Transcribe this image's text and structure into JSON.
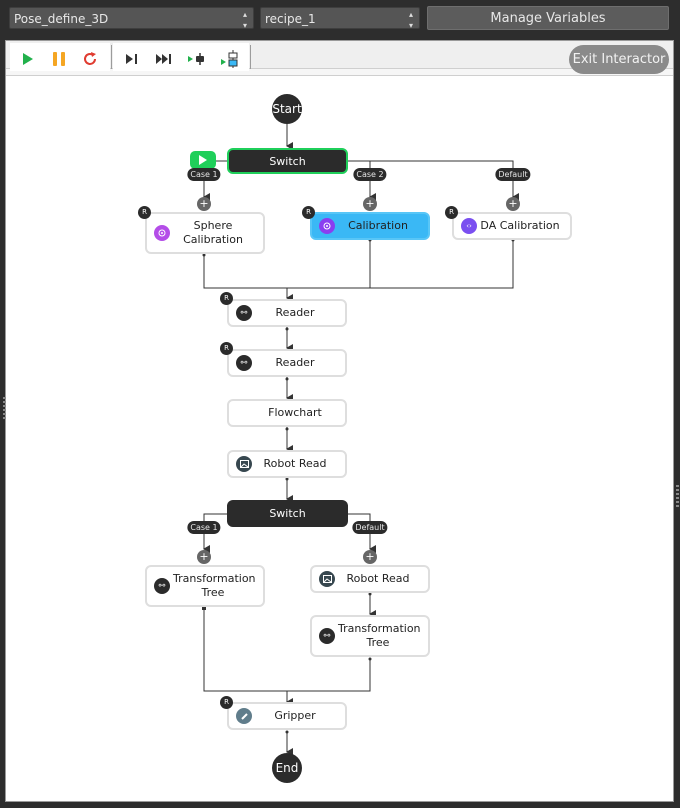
{
  "topbar": {
    "flow_select": "Pose_define_3D",
    "recipe_select": "recipe_1",
    "manage_variables_label": "Manage Variables"
  },
  "toolbar": {
    "run_icon": "play-icon",
    "pause_icon": "pause-icon",
    "reset_icon": "restart-icon",
    "step_icon": "step-icon",
    "step_all_icon": "fast-forward-icon",
    "breakpoint_icon": "breakpoint-icon",
    "run_to_node_icon": "run-to-node-icon",
    "exit_label": "Exit Interactor",
    "colors": {
      "play": "#22b14c",
      "pause": "#f5a623",
      "reset": "#e03c31"
    }
  },
  "flow": {
    "start_label": "Start",
    "end_label": "End",
    "switch1": {
      "label": "Switch",
      "cases": [
        "Case 1",
        "Case 2",
        "Default"
      ]
    },
    "branch_nodes_1": [
      {
        "label": "Sphere Calibration",
        "icon": "target-icon",
        "icon_color": "#b44de8",
        "badge": "R"
      },
      {
        "label": "Calibration",
        "icon": "target-icon",
        "icon_color": "#8a3ff0",
        "badge": "R",
        "selected": true
      },
      {
        "label": "DA Calibration",
        "icon": "code-icon",
        "icon_color": "#7a4ff0",
        "badge": "R"
      }
    ],
    "reader1": {
      "label": "Reader",
      "badge": "R",
      "icon": "link-icon"
    },
    "reader2": {
      "label": "Reader",
      "badge": "R",
      "icon": "link-icon"
    },
    "flowchart": {
      "label": "Flowchart"
    },
    "robot_read": {
      "label": "Robot Read",
      "icon": "image-icon"
    },
    "switch2": {
      "label": "Switch",
      "cases": [
        "Case 1",
        "Default"
      ]
    },
    "transform_left": {
      "label": "Transformation Tree",
      "icon": "link-icon"
    },
    "robot_read_right": {
      "label": "Robot Read",
      "icon": "image-icon"
    },
    "transform_right": {
      "label": "Transformation Tree",
      "icon": "link-icon"
    },
    "gripper": {
      "label": "Gripper",
      "badge": "R",
      "icon": "pen-icon",
      "icon_color": "#607d8b"
    },
    "plus_symbol": "+"
  }
}
